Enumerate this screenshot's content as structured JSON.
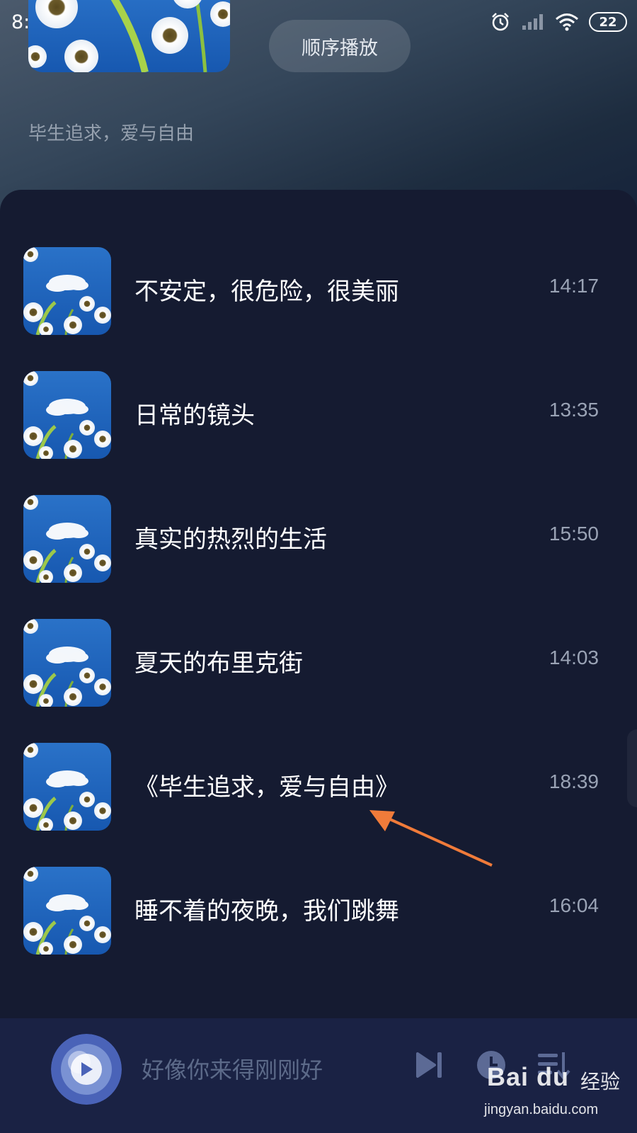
{
  "status_bar": {
    "time": "8:20",
    "battery": "22"
  },
  "header": {
    "play_mode": "顺序播放",
    "subtitle": "毕生追求，爱与自由"
  },
  "tracks": [
    {
      "title": "不安定，很危险，很美丽",
      "duration": "14:17"
    },
    {
      "title": "日常的镜头",
      "duration": "13:35"
    },
    {
      "title": "真实的热烈的生活",
      "duration": "15:50"
    },
    {
      "title": "夏天的布里克街",
      "duration": "14:03"
    },
    {
      "title": "《毕生追求，爱与自由》",
      "duration": "18:39"
    },
    {
      "title": "睡不着的夜晚，我们跳舞",
      "duration": "16:04"
    }
  ],
  "player": {
    "now_playing": "好像你来得刚刚好"
  },
  "watermark": {
    "logo": "Bai du",
    "text": "经验",
    "url": "jingyan.baidu.com"
  },
  "colors": {
    "background": "#151b31",
    "player_bar": "#1a2244",
    "accent_arrow": "#f07b3a",
    "control_icon": "#5c6a95"
  },
  "icons": [
    "alarm-icon",
    "signal-icon",
    "wifi-icon",
    "battery-icon",
    "play-icon",
    "skip-next-icon",
    "timer-icon",
    "playlist-sort-icon"
  ]
}
